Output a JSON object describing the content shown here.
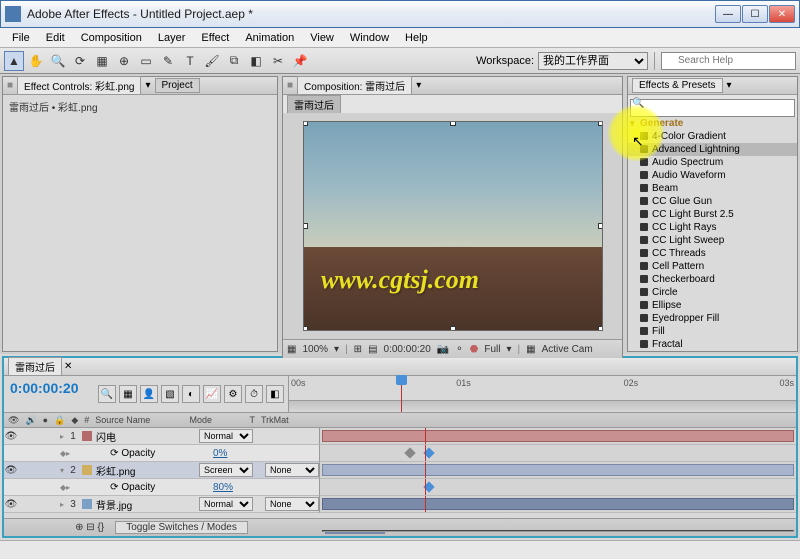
{
  "window": {
    "title": "Adobe After Effects - Untitled Project.aep *"
  },
  "menu": [
    "File",
    "Edit",
    "Composition",
    "Layer",
    "Effect",
    "Animation",
    "View",
    "Window",
    "Help"
  ],
  "toolbar": {
    "workspace_label": "Workspace:",
    "workspace_value": "我的工作界面",
    "search_placeholder": "Search Help"
  },
  "left_panel": {
    "tab1": "Effect Controls: 彩虹.png",
    "tab2": "Project",
    "item": "雷雨过后 • 彩虹.png"
  },
  "comp_panel": {
    "tab_label": "Composition: 雷雨过后",
    "chip": "雷雨过后",
    "zoom": "100%",
    "time": "0:00:00:20",
    "quality": "Full",
    "view": "Active Cam"
  },
  "fx_panel": {
    "title": "Effects & Presets",
    "category": "Generate",
    "items": [
      "4-Color Gradient",
      "Advanced Lightning",
      "Audio Spectrum",
      "Audio Waveform",
      "Beam",
      "CC Glue Gun",
      "CC Light Burst 2.5",
      "CC Light Rays",
      "CC Light Sweep",
      "CC Threads",
      "Cell Pattern",
      "Checkerboard",
      "Circle",
      "Ellipse",
      "Eyedropper Fill",
      "Fill",
      "Fractal"
    ]
  },
  "timeline": {
    "tab": "雷雨过后",
    "time": "0:00:00:20",
    "ruler": {
      "t0": "00s",
      "t1": "01s",
      "t2": "02s",
      "t3": "03s"
    },
    "cols": {
      "num": "#",
      "source": "Source Name",
      "mode": "Mode",
      "t": "T",
      "trkmat": "TrkMat"
    },
    "layers": [
      {
        "n": "1",
        "name": "闪电",
        "mode": "Normal",
        "trkmat": "",
        "color": "#b46a6a",
        "bar": "red"
      },
      {
        "opacity_label": "Opacity",
        "opacity_val": "0%"
      },
      {
        "n": "2",
        "name": "彩虹.png",
        "mode": "Screen",
        "trkmat": "None",
        "color": "#d0b060",
        "bar": "blue",
        "sel": true
      },
      {
        "opacity_label": "Opacity",
        "opacity_val": "80%"
      },
      {
        "n": "3",
        "name": "背景.jpg",
        "mode": "Normal",
        "trkmat": "None",
        "color": "#7aa0c8",
        "bar": "dark"
      }
    ],
    "toggle_btn": "Toggle Switches / Modes"
  },
  "watermark": "www.cgtsj.com"
}
